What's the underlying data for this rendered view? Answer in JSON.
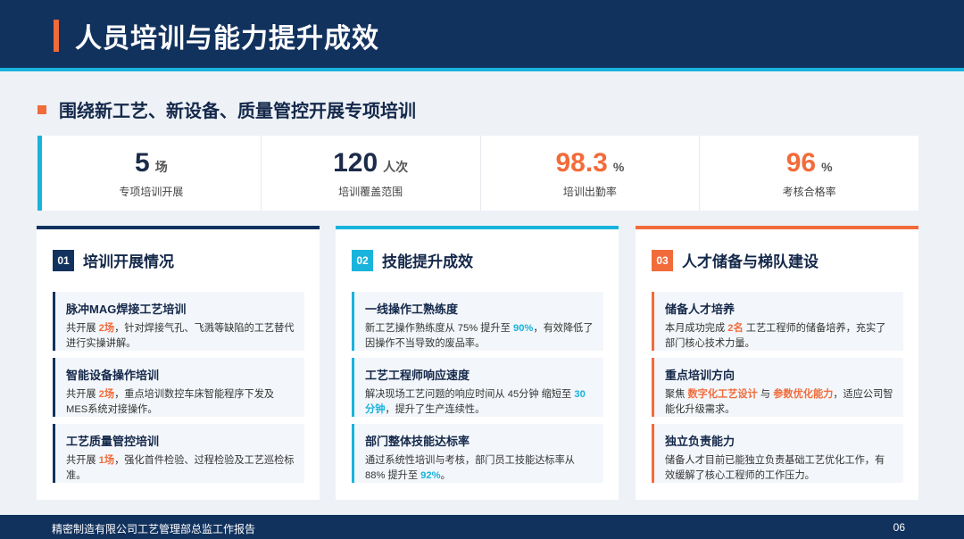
{
  "header": {
    "title": "人员培训与能力提升成效"
  },
  "subtitle": "围绕新工艺、新设备、质量管控开展专项培训",
  "stats": [
    {
      "value": "5",
      "unit": "场",
      "label": "专项培训开展"
    },
    {
      "value": "120",
      "unit": "人次",
      "label": "培训覆盖范围"
    },
    {
      "value": "98.3",
      "unit": "%",
      "label": "培训出勤率"
    },
    {
      "value": "96",
      "unit": "%",
      "label": "考核合格率"
    }
  ],
  "cards": [
    {
      "badge": "01",
      "title": "培训开展情况",
      "items": [
        {
          "title": "脉冲MAG焊接工艺培训",
          "d1": "共开展 ",
          "h1": "2场",
          "d2": "，针对焊接气孔、飞溅等缺陷的工艺替代进行实操讲解。",
          "h2": "",
          "d3": ""
        },
        {
          "title": "智能设备操作培训",
          "d1": "共开展 ",
          "h1": "2场",
          "d2": "，重点培训数控车床智能程序下发及MES系统对接操作。",
          "h2": "",
          "d3": ""
        },
        {
          "title": "工艺质量管控培训",
          "d1": "共开展 ",
          "h1": "1场",
          "d2": "，强化首件检验、过程检验及工艺巡检标准。",
          "h2": "",
          "d3": ""
        }
      ]
    },
    {
      "badge": "02",
      "title": "技能提升成效",
      "items": [
        {
          "title": "一线操作工熟练度",
          "d1": "新工艺操作熟练度从 75% 提升至 ",
          "h1": "90%",
          "d2": "，有效降低了因操作不当导致的废品率。",
          "h2": "",
          "d3": ""
        },
        {
          "title": "工艺工程师响应速度",
          "d1": "解决现场工艺问题的响应时间从 45分钟 缩短至 ",
          "h1": "30分钟",
          "d2": "，提升了生产连续性。",
          "h2": "",
          "d3": ""
        },
        {
          "title": "部门整体技能达标率",
          "d1": "通过系统性培训与考核，部门员工技能达标率从 88% 提升至 ",
          "h1": "92%",
          "d2": "。",
          "h2": "",
          "d3": ""
        }
      ]
    },
    {
      "badge": "03",
      "title": "人才储备与梯队建设",
      "items": [
        {
          "title": "储备人才培养",
          "d1": "本月成功完成 ",
          "h1": "2名",
          "d2": " 工艺工程师的储备培养，充实了部门核心技术力量。",
          "h2": "",
          "d3": ""
        },
        {
          "title": "重点培训方向",
          "d1": "聚焦 ",
          "h1": "数字化工艺设计",
          "d2": " 与 ",
          "h2": "参数优化能力",
          "d3": "，适应公司智能化升级需求。"
        },
        {
          "title": "独立负责能力",
          "d1": "储备人才目前已能独立负责基础工艺优化工作，有效缓解了核心工程师的工作压力。",
          "h1": "",
          "d2": "",
          "h2": "",
          "d3": ""
        }
      ]
    }
  ],
  "footer": {
    "text": "精密制造有限公司工艺管理部总监工作报告",
    "page": "06"
  },
  "colors": {
    "navy": "#12325e",
    "cyan": "#19b3dc",
    "orange": "#f26b3a"
  }
}
